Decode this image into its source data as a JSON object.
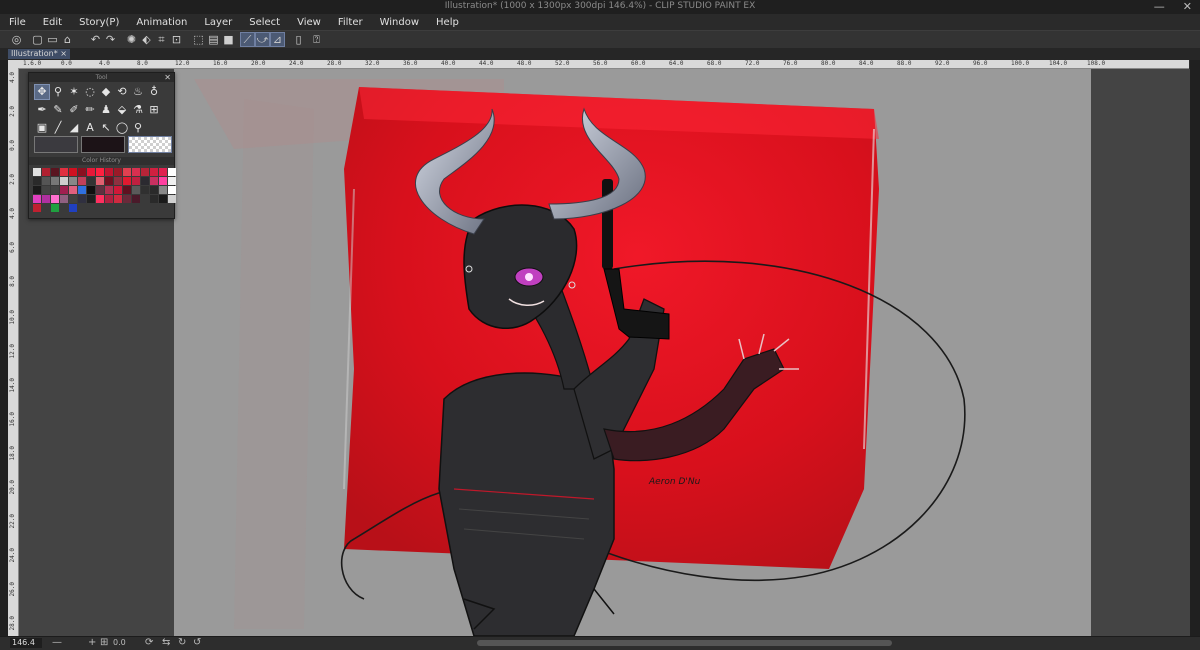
{
  "window": {
    "title": "Illustration* (1000 x 1300px 300dpi 146.4%) - CLIP STUDIO PAINT EX",
    "minimize": "—",
    "close": "✕"
  },
  "menu": [
    "File",
    "Edit",
    "Story(P)",
    "Animation",
    "Layer",
    "Select",
    "View",
    "Filter",
    "Window",
    "Help"
  ],
  "tab": {
    "label": "Illustration*",
    "close": "×"
  },
  "ruler_top_ticks": [
    "1.6",
    "0",
    "1",
    "2",
    "3",
    "4",
    "5",
    "6",
    "7",
    "8",
    "9",
    "10",
    "11",
    "12",
    "13",
    "14",
    "15",
    "16",
    "17",
    "18",
    "19",
    "20",
    "21",
    "22",
    "23",
    "24",
    "25",
    "26",
    "27",
    "28",
    "29",
    "30",
    "31",
    "32",
    "33",
    "34",
    "35",
    "36",
    "37",
    "38",
    "39",
    "40",
    "41",
    "42",
    "43",
    "44",
    "45",
    "46",
    "47",
    "48",
    "49",
    "50",
    "51",
    "52",
    "53",
    "54",
    "55",
    "56",
    "57",
    "58",
    "59",
    "60",
    "61",
    "62",
    "63",
    "64",
    "65",
    "66",
    "67",
    "68",
    "69",
    "70",
    "71",
    "72",
    "73",
    "74",
    "75",
    "76",
    "77",
    "78",
    "79",
    "80",
    "81",
    "82",
    "83",
    "84",
    "85",
    "86",
    "87",
    "88",
    "89",
    "90",
    "91",
    "92",
    "93",
    "94",
    "95",
    "96",
    "97",
    "98",
    "99",
    "100",
    "101",
    "102",
    "103",
    "104",
    "105",
    "106",
    "107",
    "108",
    "109",
    "110",
    "111",
    "112",
    "113",
    "114",
    "115",
    "116",
    "117",
    "118",
    "119",
    "120",
    "121",
    "122",
    "123",
    "124",
    "125",
    "126",
    "127",
    "128",
    "129",
    "130",
    "131",
    "132",
    "133",
    "134",
    "135",
    "136",
    "137",
    "138",
    "139",
    "140",
    "141",
    "142",
    "143",
    "144",
    "145",
    "146",
    "147",
    "148",
    "149",
    "150",
    "151",
    "152",
    "153",
    "154",
    "155",
    "156",
    "157",
    "158",
    "159",
    "160",
    "161",
    "162",
    "163",
    "164",
    "165",
    "166",
    "167",
    "168",
    "169",
    "170",
    "171",
    "172",
    "173",
    "174",
    "175",
    "176",
    "177",
    "178",
    "179",
    "180",
    "181",
    "182",
    "183",
    "184",
    "185",
    "186",
    "187",
    "188",
    "189",
    "190",
    "191",
    "192",
    "193",
    "194",
    "195",
    "196",
    "197",
    "198",
    "199",
    "200",
    "201",
    "202",
    "203",
    "204",
    "205",
    "206",
    "207",
    "208",
    "209",
    "210",
    "211",
    "212",
    "213",
    "214",
    "215",
    "216",
    "217",
    "218",
    "219",
    "220",
    "221",
    "222",
    "223",
    "224",
    "225",
    "226",
    "227",
    "228",
    "229",
    "230",
    "231",
    "232",
    "233",
    "234",
    "235",
    "236",
    "237",
    "238",
    "239",
    "240",
    "241",
    "242",
    "243",
    "244",
    "245",
    "246",
    "247",
    "248",
    "249",
    "250",
    "251",
    "252",
    "253",
    "254",
    "255",
    "256",
    "257",
    "258",
    "259",
    "260",
    "261",
    "262",
    "263",
    "264",
    "265",
    "266",
    "267",
    "268",
    "269",
    "270",
    "271",
    "272",
    "273",
    "274",
    "275",
    "276",
    "277",
    "278",
    "279",
    "280",
    "281",
    "282",
    "283",
    "284",
    "285",
    "286",
    "287",
    "288",
    "289",
    "290",
    "291",
    "292",
    "293",
    "294",
    "295",
    "296",
    "297",
    "298",
    "299",
    "300",
    "301",
    "302",
    "303",
    "304",
    "305",
    "306",
    "307",
    "308",
    "309",
    "310",
    "311",
    "312",
    "313",
    "314",
    "315",
    "316",
    "317",
    "318",
    "319",
    "320",
    "321",
    "322",
    "323",
    "324",
    "325",
    "326",
    "327",
    "328",
    "329",
    "330",
    "331",
    "332",
    "333",
    "334",
    "335",
    "336",
    "337",
    "338",
    "339",
    "340",
    "341",
    "342",
    "343",
    "344",
    "345",
    "346",
    "347",
    "348",
    "349",
    "350",
    "351",
    "352",
    "353",
    "354",
    "355",
    "356",
    "357",
    "358",
    "359",
    "360",
    "361",
    "362",
    "363",
    "364",
    "365",
    "366",
    "367",
    "368",
    "369",
    "370",
    "371",
    "372",
    "373",
    "374",
    "375",
    "376",
    "377",
    "378",
    "379",
    "380",
    "381",
    "382",
    "383",
    "384",
    "385",
    "386",
    "387",
    "388",
    "389",
    "390",
    "391",
    "392",
    "393",
    "394",
    "395",
    "396",
    "397",
    "398",
    "399",
    "400"
  ],
  "ruler_top_labels": [
    "1.6.0",
    "0.0",
    "4.0",
    "8.0",
    "12.0",
    "16.0",
    "20.0",
    "24.0",
    "28.0",
    "32.0",
    "36.0",
    "40.0",
    "44.0",
    "48.0",
    "52.0",
    "56.0",
    "60.0",
    "64.0",
    "68.0",
    "72.0",
    "76.0",
    "80.0",
    "84.0",
    "88.0",
    "92.0",
    "96.0",
    "100.0",
    "104.0",
    "108.0"
  ],
  "ruler_left_labels": [
    "4.0",
    "2.0",
    "0.0",
    "2.0",
    "4.0",
    "6.0",
    "8.0",
    "10.0",
    "12.0",
    "14.0",
    "16.0",
    "18.0",
    "20.0",
    "22.0",
    "24.0",
    "26.0",
    "28.0"
  ],
  "tool_palette": {
    "title": "Tool",
    "color_history_title": "Color History",
    "tools": [
      "grid-move-icon",
      "zoom-icon",
      "magic-wand-icon",
      "lasso-icon",
      "eraser-icon",
      "rotate-icon",
      "blend-icon",
      "droplet-icon",
      "pen-icon",
      "pencil-icon",
      "brush-icon",
      "marker-icon",
      "airbrush-icon",
      "fill-icon",
      "eyedropper-icon",
      "frame-icon",
      "gradient-icon",
      "line-icon",
      "ruler-icon",
      "text-icon",
      "select-arrow-icon",
      "balloon-icon",
      "search-icon"
    ],
    "main_color": "#3b3a3f",
    "sub_color": "#1c1317",
    "transparent_label": "transparent"
  },
  "color_history": [
    "#e0e0e0",
    "#b02030",
    "#5a1520",
    "#e03040",
    "#d01020",
    "#8a1020",
    "#e81838",
    "#ff2040",
    "#c01530",
    "#9a1a28",
    "#e04050",
    "#d83050",
    "#b52438",
    "#d02040",
    "#e02050",
    "#ffffff",
    "#2a2a2a",
    "#555",
    "#777",
    "#cfcfcf",
    "#888",
    "#c0405a",
    "#333",
    "#e06070",
    "#701020",
    "#903040",
    "#e01a30",
    "#c02040",
    "#2b2a30",
    "#c83060",
    "#ff40a0",
    "#f0f0f0",
    "#1a1a1a",
    "#444",
    "#444",
    "#a02050",
    "#e06080",
    "#3070e0",
    "#101010",
    "#603040",
    "#b03050",
    "#d01838",
    "#601020",
    "#5a5a5a",
    "#303030",
    "#2a2a2a",
    "#888",
    "#ffffff",
    "#e040c0",
    "#b030a0",
    "#ff70d0",
    "#906080",
    "#404040",
    "#303040",
    "#202020",
    "#ff3060",
    "#b02040",
    "#cf2a40",
    "#6a2a3a",
    "#4a1a2a",
    "#3a3a3a",
    "#2a2a2a",
    "#1a1a1a",
    "#d0d0d0",
    "#c02030",
    "#3a3a3a",
    "#20a040",
    "#3a3a3a",
    "#2040c0",
    "#3a3a3a",
    "#3a3a3a",
    "#3a3a3a"
  ],
  "status": {
    "zoom": "146.4",
    "angle": "0.0"
  },
  "artwork": {
    "signature": "Aeron D'Nu"
  }
}
